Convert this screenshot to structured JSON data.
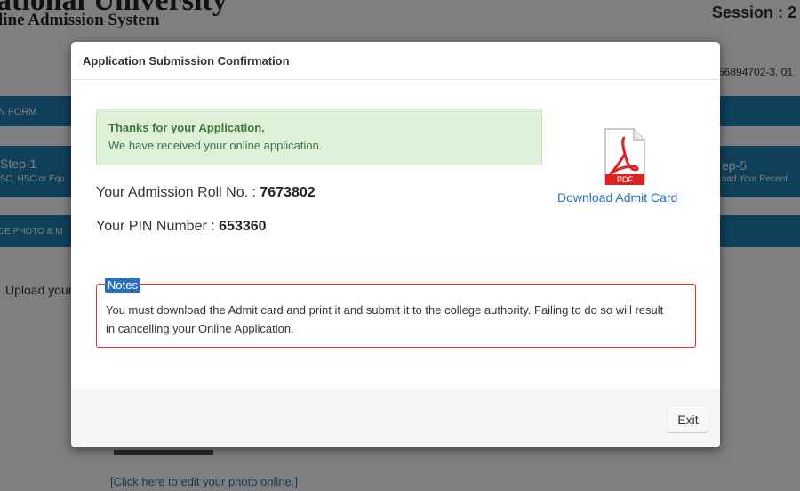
{
  "background": {
    "university_title": "ational University",
    "system_title": "line Admission System",
    "session": "Session : 2",
    "contact": "56894702-3, 01",
    "form_bar_label": "N FORM",
    "step1": {
      "name": "Step-1",
      "desc": "SC, HSC or Equ"
    },
    "step5": {
      "name": "ep-5",
      "desc": "oad Your Recent"
    },
    "upload_bar_label": "DE PHOTO & M",
    "upload_label": "Upload your",
    "edit_link": "[Click here to edit your photo online.]"
  },
  "modal": {
    "title": "Application Submission Confirmation",
    "alert": {
      "title": "Thanks for your Application.",
      "message": "We have received your online application."
    },
    "roll_label": "Your Admission Roll No. : ",
    "roll_value": "7673802",
    "pin_label": "Your PIN Number : ",
    "pin_value": "653360",
    "pdf_badge": "PDF",
    "download_label": "Download Admit Card",
    "notes_badge": "Notes",
    "notes_text": "You must download the Admit card and print it and submit it to the college authority. Failing to do so will result in cancelling your Online Application.",
    "exit_label": "Exit"
  },
  "colors": {
    "accent": "#1f7fb6",
    "link": "#2a6ebb",
    "success_bg": "#dff0d8",
    "success_text": "#3c763d",
    "notes_border": "#dd3333"
  },
  "icons": {
    "pdf": "pdf-file-icon"
  }
}
